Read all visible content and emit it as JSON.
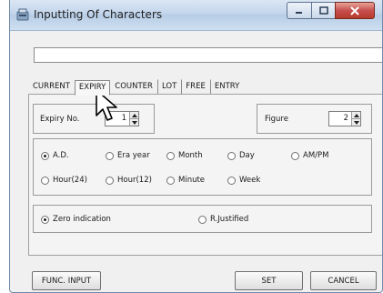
{
  "window": {
    "title": "Inputting Of Characters"
  },
  "text_input": {
    "value": ""
  },
  "tabs": [
    {
      "label": "CURRENT",
      "active": false
    },
    {
      "label": "EXPIRY",
      "active": true
    },
    {
      "label": "COUNTER",
      "active": false
    },
    {
      "label": "LOT",
      "active": false
    },
    {
      "label": "FREE",
      "active": false
    },
    {
      "label": "ENTRY",
      "active": false
    }
  ],
  "expiry": {
    "expiry_no_label": "Expiry No.",
    "expiry_no_value": "1",
    "figure_label": "Figure",
    "figure_value": "2"
  },
  "format_options": {
    "selected": "A.D.",
    "items": [
      "A.D.",
      "Era year",
      "Month",
      "Day",
      "AM/PM",
      "Hour(24)",
      "Hour(12)",
      "Minute",
      "Week"
    ]
  },
  "display_options": {
    "selected": "Zero indication",
    "items": [
      "Zero indication",
      "R.Justified"
    ]
  },
  "buttons": {
    "func_input": "FUNC. INPUT",
    "set": "SET",
    "cancel": "CANCEL"
  },
  "colors": {
    "title_bar": "#c3d6ec",
    "close_button": "#c75050",
    "dialog": "#f0f0f0"
  }
}
